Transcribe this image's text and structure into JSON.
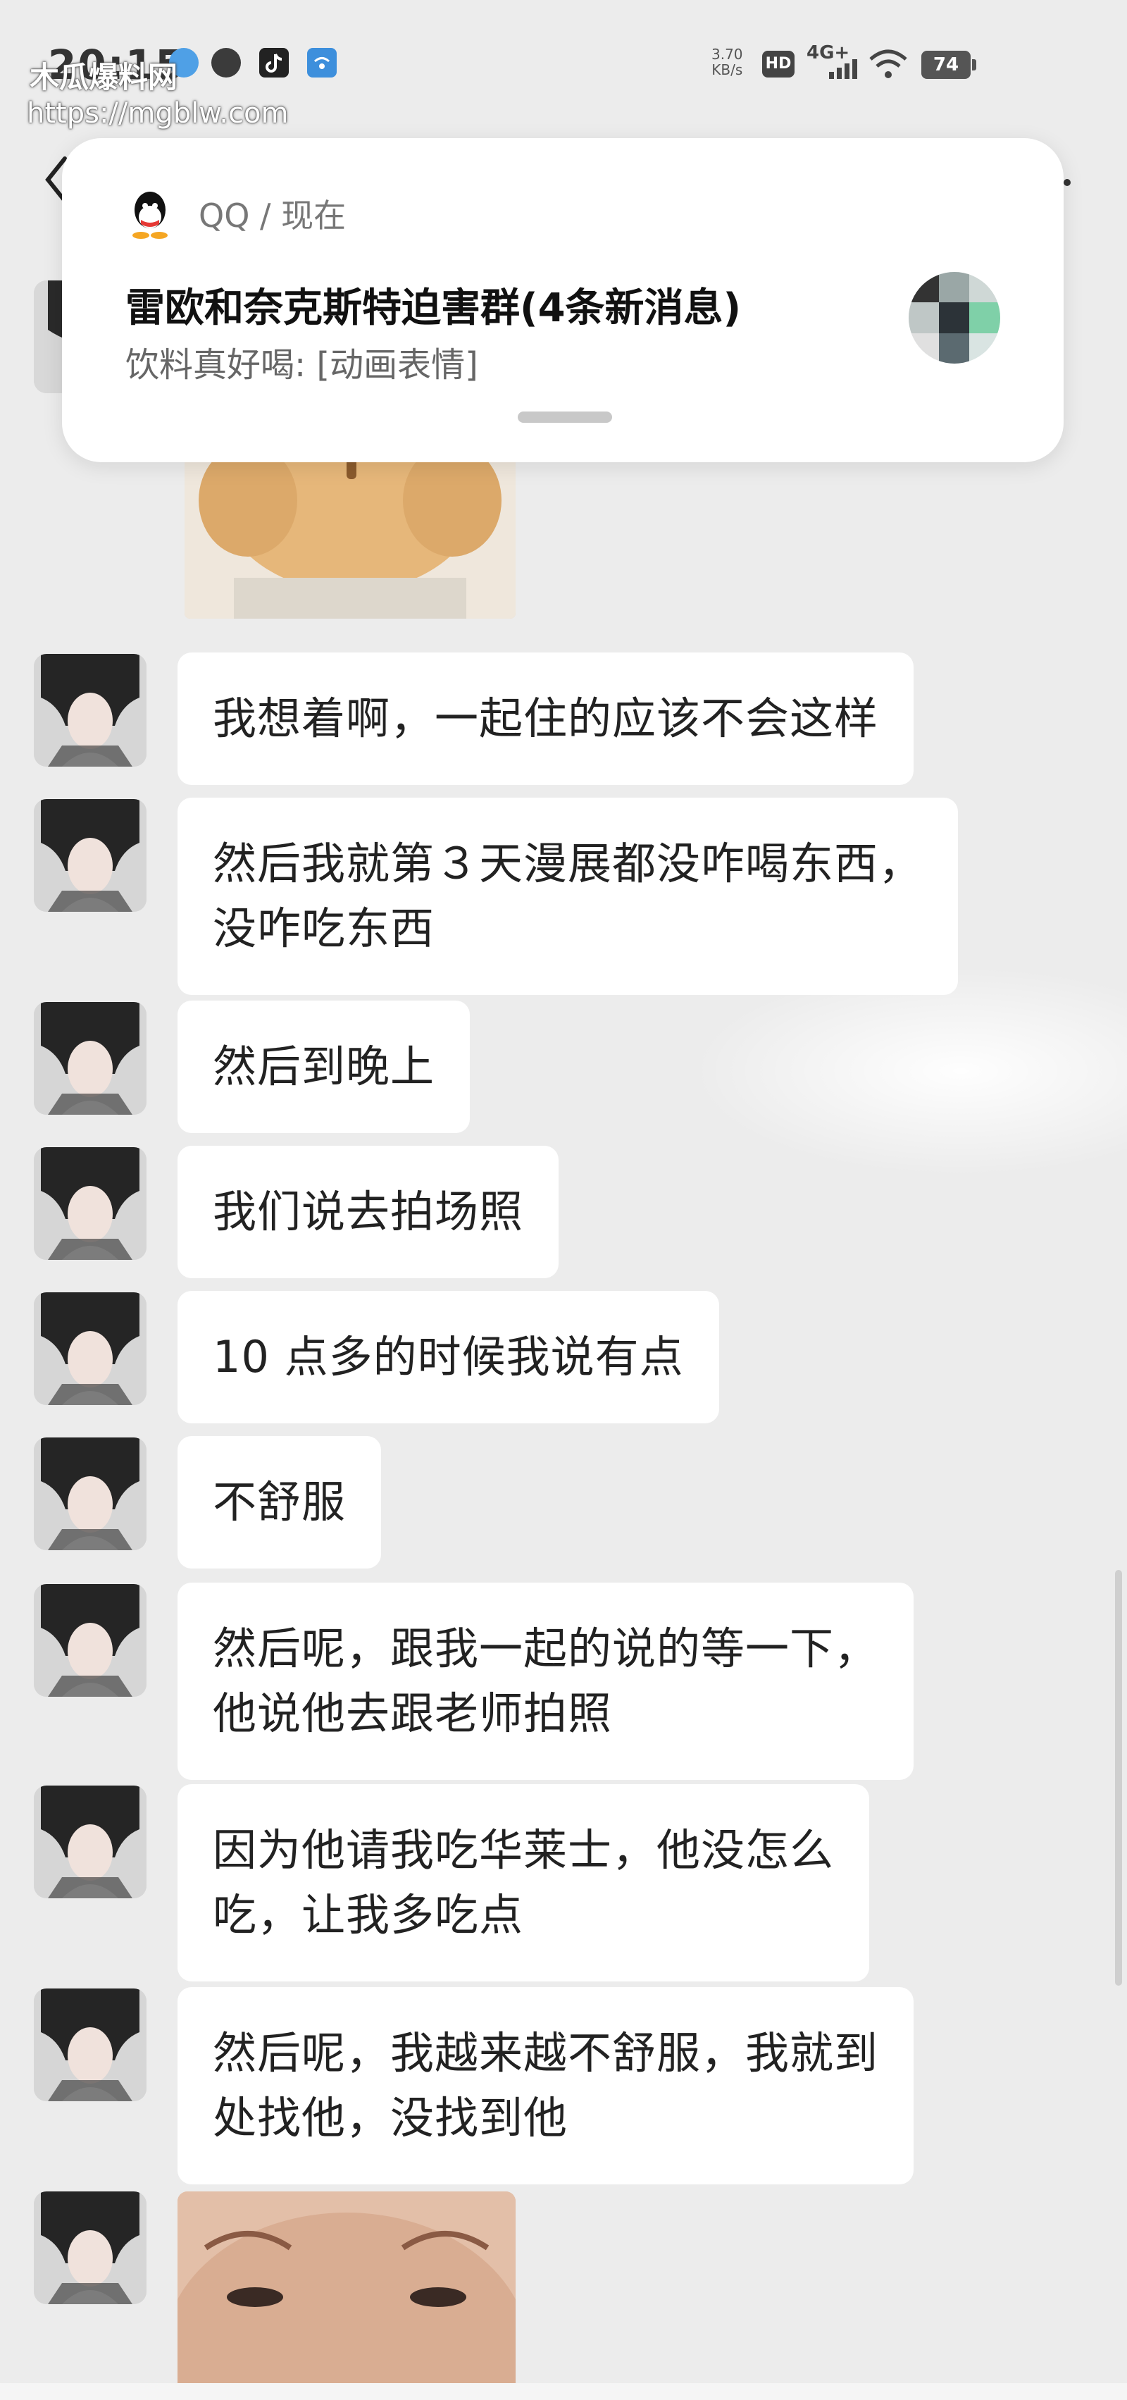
{
  "watermark": {
    "title": "木瓜爆料网",
    "url": "https://mgblw.com"
  },
  "status_bar": {
    "time": "20:15",
    "net_speed_value": "3.70",
    "net_speed_unit": "KB/s",
    "hd": "HD",
    "network": "4G+",
    "battery": "74"
  },
  "notification": {
    "app": "QQ / 现在",
    "title": "雷欧和奈克斯特迫害群(4条新消息)",
    "body": "饮料真好喝: [动画表情]"
  },
  "messages": [
    {
      "lines": [
        "我想着啊，一起住的应该不会这样"
      ]
    },
    {
      "lines": [
        "然后我就第３天漫展都没咋喝东西，",
        "没咋吃东西"
      ]
    },
    {
      "lines": [
        "然后到晚上"
      ]
    },
    {
      "lines": [
        "我们说去拍场照"
      ]
    },
    {
      "lines": [
        "10 点多的时候我说有点"
      ]
    },
    {
      "lines": [
        "不舒服"
      ]
    },
    {
      "lines": [
        "然后呢，跟我一起的说的等一下，",
        "他说他去跟老师拍照"
      ]
    },
    {
      "lines": [
        "因为他请我吃华莱士，他没怎么",
        "吃，让我多吃点"
      ]
    },
    {
      "lines": [
        "然后呢，我越来越不舒服，我就到",
        "处找他，没找到他"
      ]
    }
  ],
  "colors": {
    "background": "#ececec",
    "bubble": "#ffffff",
    "text": "#222222"
  }
}
